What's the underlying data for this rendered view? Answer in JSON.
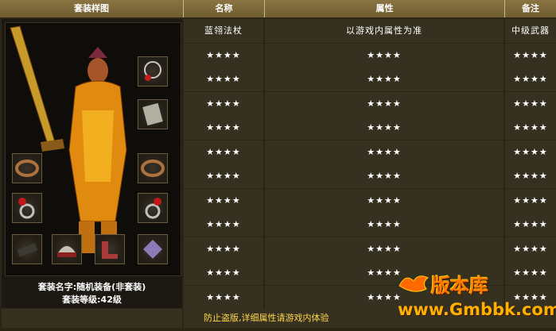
{
  "headers": {
    "preview": "套装样图",
    "name": "名称",
    "attributes": "属性",
    "note": "备注"
  },
  "rows": [
    {
      "name": "蓝翎法杖",
      "attr": "以游戏内属性为准",
      "note": "中级武器"
    },
    {
      "name": "★★★★",
      "attr": "★★★★",
      "note": "★★★★"
    },
    {
      "name": "★★★★",
      "attr": "★★★★",
      "note": "★★★★"
    },
    {
      "name": "★★★★",
      "attr": "★★★★",
      "note": "★★★★"
    },
    {
      "name": "★★★★",
      "attr": "★★★★",
      "note": "★★★★"
    },
    {
      "name": "★★★★",
      "attr": "★★★★",
      "note": "★★★★"
    },
    {
      "name": "★★★★",
      "attr": "★★★★",
      "note": "★★★★"
    },
    {
      "name": "★★★★",
      "attr": "★★★★",
      "note": "★★★★"
    },
    {
      "name": "★★★★",
      "attr": "★★★★",
      "note": "★★★★"
    },
    {
      "name": "★★★★",
      "attr": "★★★★",
      "note": "★★★★"
    },
    {
      "name": "★★★★",
      "attr": "★★★★",
      "note": "★★★★"
    },
    {
      "name": "★★★★",
      "attr": "★★★★",
      "note": "★★★★"
    }
  ],
  "set_info": {
    "name_line": "套装名字:随机装备(非套装)",
    "level_line": "套装等级:42级"
  },
  "footer_text": "防止盗版,详细属性请游戏内体验",
  "watermark": {
    "title": "版本库",
    "url": "www.Gmbbk.com"
  },
  "colors": {
    "header_bg": "#7d6a3a",
    "cell_bg": "#35301f",
    "grid": "#b8a77a",
    "footer_text": "#ffd84a",
    "watermark": "#ff7a00"
  }
}
